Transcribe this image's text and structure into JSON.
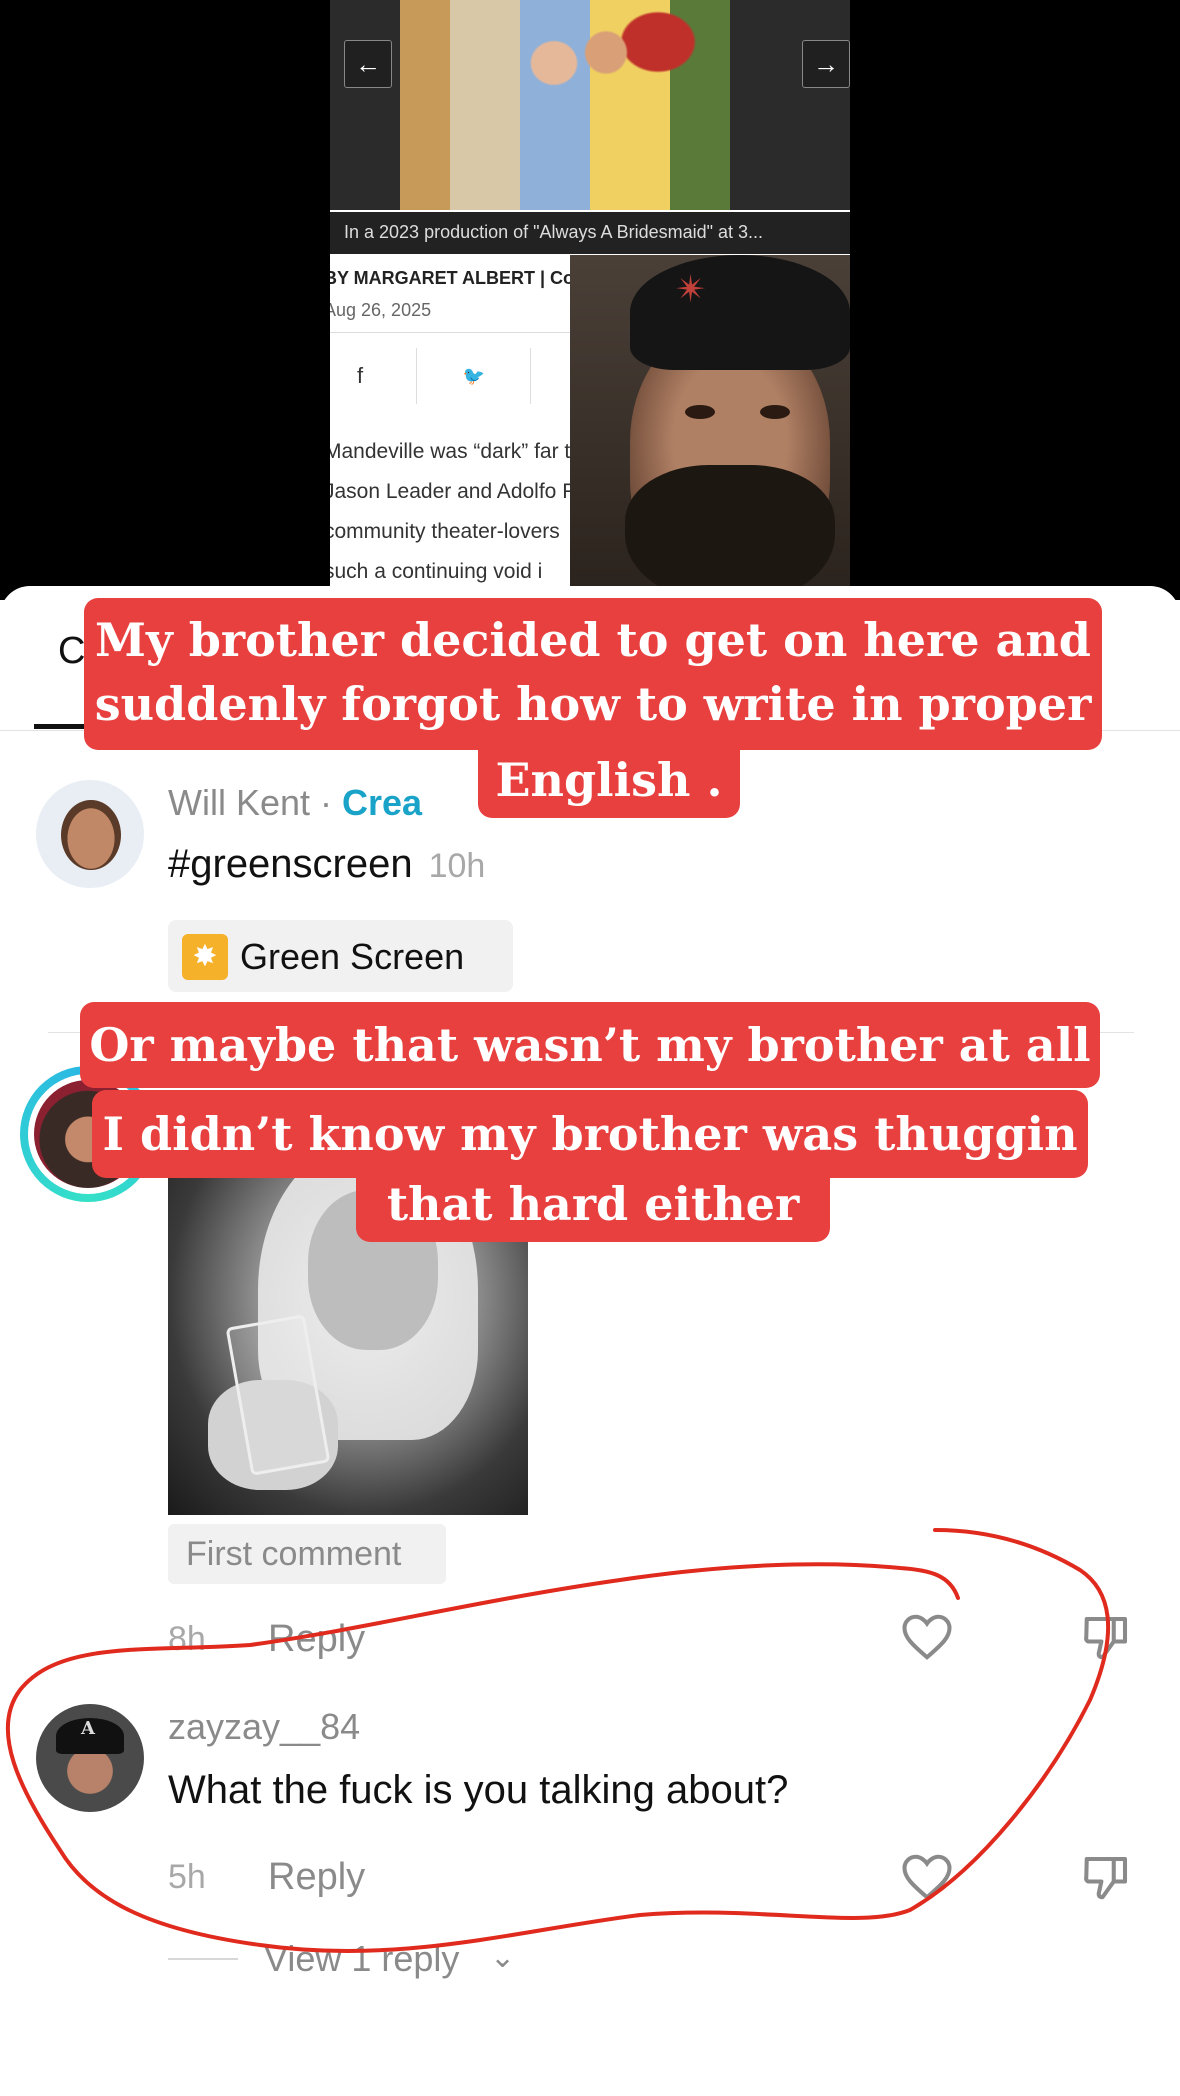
{
  "article": {
    "nav_prev": "←",
    "nav_next": "→",
    "photo_caption": "In a 2023 production of \"Always A Bridesmaid\" at 3...",
    "byline": "BY MARGARET ALBERT | Contribu",
    "date": "Aug 26, 2025",
    "share": {
      "facebook": "f",
      "twitter": "🐦",
      "whatsapp": "✆"
    },
    "body_lines": [
      "Mandeville was “dark” far too lo",
      "Jason Leader and Adolfo Rodrig",
      "community theater-lovers",
      "such a continuing void i"
    ]
  },
  "overlays": {
    "caption_1": [
      "My brother decided to get on here and",
      "suddenly forgot how to write in proper",
      "English ."
    ],
    "caption_2": "Or maybe that wasn’t my brother at all",
    "caption_3": [
      "I didn’t know my brother was thuggin",
      "that hard either"
    ]
  },
  "comments_tab": {
    "label_visible_char": "C"
  },
  "post": {
    "author": "Will Kent",
    "separator": " · ",
    "creator_label": "Crea",
    "text": "#greenscreen",
    "time": "10h",
    "effect_label": "Green Screen",
    "effect_icon": "sparkle-icon"
  },
  "comment_1": {
    "label": "First comment",
    "time": "8h",
    "reply": "Reply"
  },
  "comment_2": {
    "username": "zayzay__84",
    "text": "What the fuck is you talking about?",
    "time": "5h",
    "reply": "Reply",
    "view_replies": "View 1 reply",
    "chevron": "⌄"
  },
  "colors": {
    "caption_bg": "#e8403f",
    "creator_accent": "#1aa3c8",
    "annotation_stroke": "#e02a1e",
    "effect_icon_bg": "#f6b12a"
  }
}
